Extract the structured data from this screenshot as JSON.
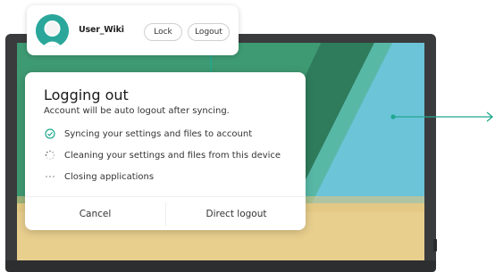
{
  "user_card": {
    "username": "User_Wiki",
    "lock_label": "Lock",
    "logout_label": "Logout"
  },
  "dialog": {
    "title": "Logging out",
    "subtitle": "Account will be auto logout after syncing.",
    "steps": [
      {
        "label": "Syncing your settings and files to account",
        "icon": "check-circle-icon"
      },
      {
        "label": "Cleaning your settings and files from this device",
        "icon": "spinner-icon"
      },
      {
        "label": "Closing applications",
        "icon": "ellipsis-icon"
      }
    ],
    "cancel_label": "Cancel",
    "direct_logout_label": "Direct logout"
  },
  "colors": {
    "accent": "#21a88f",
    "avatar_bg": "#2aa79a",
    "wallpaper_green": "#3e9a72",
    "wallpaper_teal": "#6cc4d8",
    "wallpaper_sand": "#e9cf8e"
  }
}
